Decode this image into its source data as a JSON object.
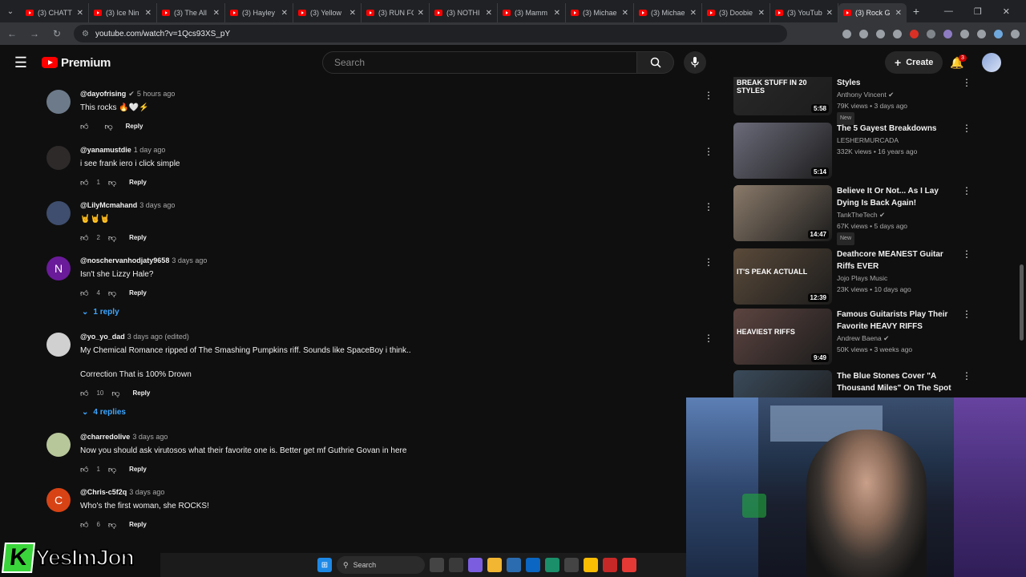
{
  "browser": {
    "tabs": [
      {
        "title": "(3) CHATT"
      },
      {
        "title": "(3) Ice Nin"
      },
      {
        "title": "(3) The All"
      },
      {
        "title": "(3) Hayley"
      },
      {
        "title": "(3) Yellow"
      },
      {
        "title": "(3) RUN FO"
      },
      {
        "title": "(3) NOTHI"
      },
      {
        "title": "(3) Mamm"
      },
      {
        "title": "(3) Michae"
      },
      {
        "title": "(3) Michae"
      },
      {
        "title": "(3) Doobie"
      },
      {
        "title": "(3) YouTub"
      },
      {
        "title": "(3) Rock G"
      }
    ],
    "url": "youtube.com/watch?v=1Qcs93XS_pY"
  },
  "header": {
    "logo_text": "Premium",
    "search_placeholder": "Search",
    "create_label": "Create",
    "notif_count": "3"
  },
  "comments": [
    {
      "handle": "@dayofrising",
      "verified": true,
      "time": "5 hours ago",
      "text": "This rocks 🔥🤍⚡",
      "likes": "",
      "avatar_letter": "",
      "avatar_color": "#6d7a8a",
      "replies": ""
    },
    {
      "handle": "@yanamustdie",
      "verified": false,
      "time": "1 day ago",
      "text": "i see frank iero i click simple",
      "likes": "1",
      "avatar_letter": "",
      "avatar_color": "#2e2a2a",
      "replies": ""
    },
    {
      "handle": "@LilyMcmahand",
      "verified": false,
      "time": "3 days ago",
      "text": "🤘🤘🤘",
      "likes": "2",
      "avatar_letter": "",
      "avatar_color": "#3f4e6e",
      "replies": ""
    },
    {
      "handle": "@noschervanhodjaty9658",
      "verified": false,
      "time": "3 days ago",
      "text": "Isn't she Lizzy Hale?",
      "likes": "4",
      "avatar_letter": "N",
      "avatar_color": "#6a1b9a",
      "replies": "1 reply"
    },
    {
      "handle": "@yo_yo_dad",
      "verified": false,
      "time": "3 days ago (edited)",
      "text": "My Chemical Romance ripped of The Smashing Pumpkins riff. Sounds like SpaceBoy i think..",
      "text2": "Correction That is 100% Drown",
      "likes": "10",
      "avatar_letter": "",
      "avatar_color": "#d0d0d0",
      "replies": "4 replies"
    },
    {
      "handle": "@charredolive",
      "verified": false,
      "time": "3 days ago",
      "text": "Now you should ask virutosos what their favorite one is.  Better get mf Guthrie Govan in here",
      "likes": "1",
      "avatar_letter": "",
      "avatar_color": "#b8c79a",
      "replies": ""
    },
    {
      "handle": "@Chris-c5f2q",
      "verified": false,
      "time": "3 days ago",
      "text": "Who's the first woman, she ROCKS!",
      "likes": "6",
      "avatar_letter": "C",
      "avatar_color": "#d84315",
      "replies": ""
    }
  ],
  "reply_label": "Reply",
  "sidebar": {
    "videos": [
      {
        "title": "Styles",
        "channel": "Anthony Vincent",
        "verified": true,
        "meta": "79K views • 3 days ago",
        "new": "New",
        "duration": "5:58",
        "thumb_text": "BREAK STUFF IN 20 STYLES",
        "thumb_color": "#2a2a2a"
      },
      {
        "title": "The 5 Gayest Breakdowns",
        "channel": "LESHERMURCADA",
        "verified": false,
        "meta": "332K views • 16 years ago",
        "new": "",
        "duration": "5:14",
        "thumb_text": "",
        "thumb_color": "#6b6b7a"
      },
      {
        "title": "Believe It Or Not... As I Lay Dying Is Back Again!",
        "channel": "TankTheTech",
        "verified": true,
        "meta": "67K views • 5 days ago",
        "new": "New",
        "duration": "14:47",
        "thumb_text": "",
        "thumb_color": "#8a7a6a"
      },
      {
        "title": "Deathcore MEANEST Guitar Riffs EVER",
        "channel": "Jojo Plays Music",
        "verified": false,
        "meta": "23K views • 10 days ago",
        "new": "",
        "duration": "12:39",
        "thumb_text": "IT'S PEAK ACTUALL",
        "thumb_color": "#5a4a3a"
      },
      {
        "title": "Famous Guitarists Play Their Favorite HEAVY RIFFS",
        "channel": "Andrew Baena",
        "verified": true,
        "meta": "50K views • 3 weeks ago",
        "new": "",
        "duration": "9:49",
        "thumb_text": "HEAVIEST RIFFS",
        "thumb_color": "#5c4440"
      },
      {
        "title": "The Blue Stones Cover \"A Thousand Miles\" On The Spot",
        "channel": "",
        "verified": false,
        "meta": "",
        "new": "",
        "duration": "",
        "thumb_text": "",
        "thumb_color": "#3a4a5a"
      }
    ]
  },
  "overlay": {
    "brand_letter": "K",
    "brand_name": "YesImJon"
  },
  "taskbar": {
    "search_label": "Search"
  }
}
